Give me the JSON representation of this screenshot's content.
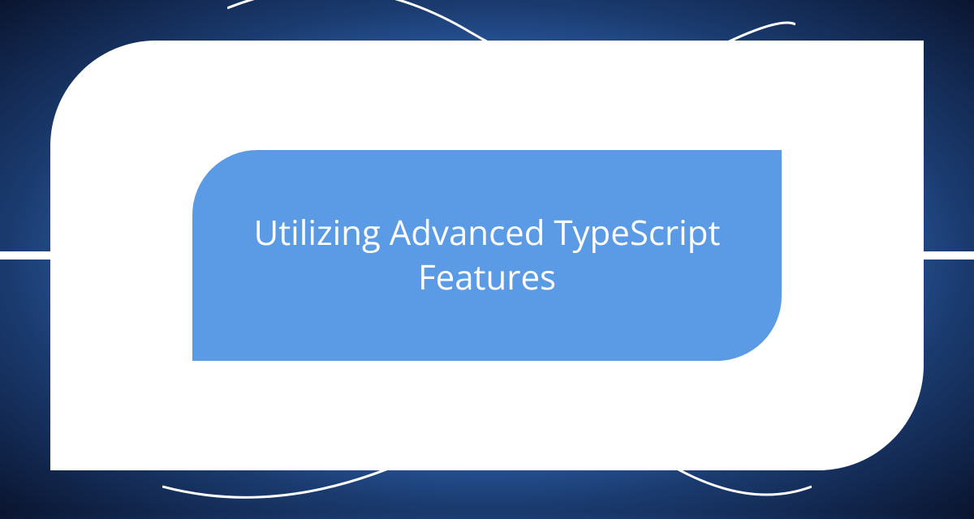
{
  "title": "Utilizing Advanced TypeScript Features",
  "colors": {
    "card_bg": "#ffffff",
    "inner_bg": "#5b9be6",
    "text": "#ffffff",
    "curve": "#ffffff"
  }
}
